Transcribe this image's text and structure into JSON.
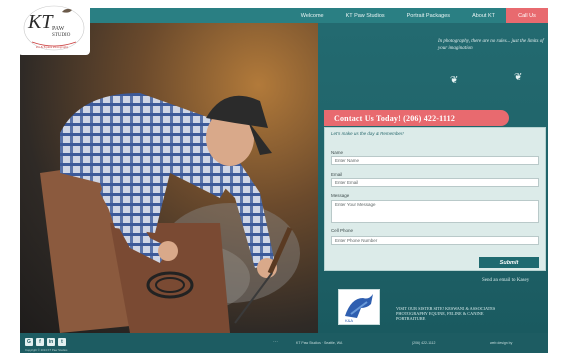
{
  "nav": {
    "items": [
      "Welcome",
      "KT Paw Studios",
      "Portrait Packages",
      "About KT"
    ],
    "cta_label": "Call Us"
  },
  "logo": {
    "text": "KT",
    "subtext": "PAW STUDIO"
  },
  "hero": {
    "description_icon": "photo-farrier-icon"
  },
  "panel": {
    "tagline": "In photography, there are no rules... just the limits of your imagination",
    "paw_icon": "paw-icon"
  },
  "contact": {
    "title": "Contact Us Today!  (206) 422-1112",
    "form_title": "Let's make us the day & Remember!",
    "name_label": "Name",
    "name_value": "Enter Name",
    "email_label": "Email",
    "email_value": "Enter Email",
    "message_label": "Message",
    "message_value": "Enter Your Message",
    "phone_label": "Cell Phone",
    "phone_value": "Enter Phone Number",
    "submit_label": "Submit",
    "send_email": "Send an email to Kasey"
  },
  "promo": {
    "text": "VISIT OUR SISTER SITE! KESWANI & ASSOCIATES PHOTOGRAPHY EQUINE, FELINE & CANINE PORTRAITURE"
  },
  "footer": {
    "social": [
      "G",
      "f",
      "in",
      "t"
    ],
    "copyright": "Copyright © 2013 KT Paw Studios",
    "address": "KT Paw Studios · Seattle, WA",
    "phone": "(206) 422-1112",
    "credit": "web design by"
  },
  "colors": {
    "teal": "#236a70",
    "accent": "#e86a6f",
    "footer": "#1d5c62"
  }
}
